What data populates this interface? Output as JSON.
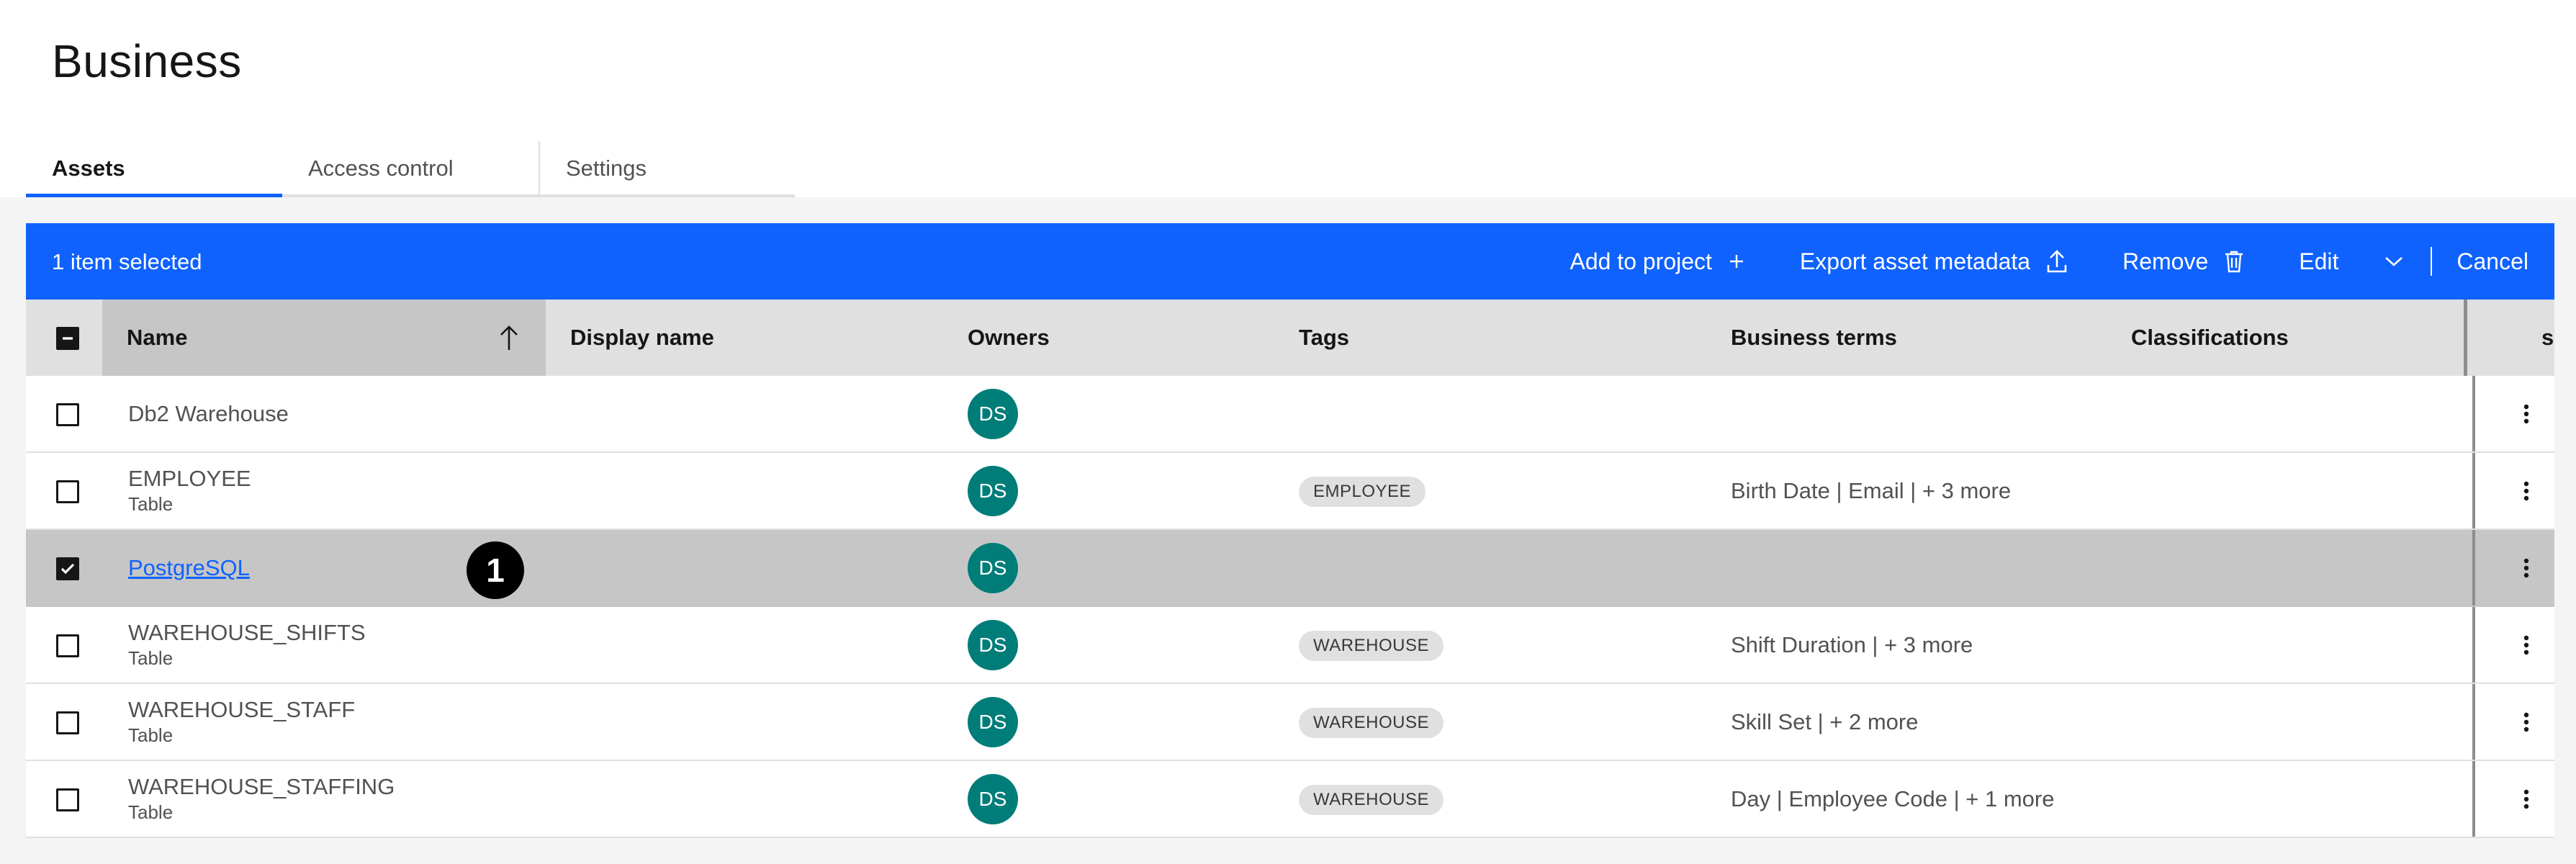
{
  "page": {
    "title": "Business"
  },
  "tabs": [
    {
      "label": "Assets",
      "active": true
    },
    {
      "label": "Access control",
      "active": false
    },
    {
      "label": "Settings",
      "active": false
    }
  ],
  "batch_bar": {
    "selected_text": "1 item selected",
    "actions": {
      "add_to_project": "Add to project",
      "export_metadata": "Export asset metadata",
      "remove": "Remove",
      "edit": "Edit",
      "cancel": "Cancel"
    }
  },
  "table": {
    "columns": {
      "name": "Name",
      "display_name": "Display name",
      "owners": "Owners",
      "tags": "Tags",
      "business_terms": "Business terms",
      "classifications": "Classifications",
      "truncated": "s"
    },
    "rows": [
      {
        "name": "Db2 Warehouse",
        "type": "",
        "owner": "DS",
        "tag": "",
        "terms": "",
        "selected": false,
        "link": false
      },
      {
        "name": "EMPLOYEE",
        "type": "Table",
        "owner": "DS",
        "tag": "EMPLOYEE",
        "terms": "Birth Date | Email | + 3 more",
        "selected": false,
        "link": false
      },
      {
        "name": "PostgreSQL",
        "type": "",
        "owner": "DS",
        "tag": "",
        "terms": "",
        "selected": true,
        "link": true
      },
      {
        "name": "WAREHOUSE_SHIFTS",
        "type": "Table",
        "owner": "DS",
        "tag": "WAREHOUSE",
        "terms": "Shift Duration | + 3 more",
        "selected": false,
        "link": false
      },
      {
        "name": "WAREHOUSE_STAFF",
        "type": "Table",
        "owner": "DS",
        "tag": "WAREHOUSE",
        "terms": "Skill Set | + 2 more",
        "selected": false,
        "link": false
      },
      {
        "name": "WAREHOUSE_STAFFING",
        "type": "Table",
        "owner": "DS",
        "tag": "WAREHOUSE",
        "terms": "Day | Employee Code | + 1 more",
        "selected": false,
        "link": false
      }
    ]
  },
  "callout": {
    "number": "1"
  },
  "colors": {
    "primary": "#0f62fe",
    "avatar": "#007d79",
    "selected_row": "#c6c6c6"
  }
}
